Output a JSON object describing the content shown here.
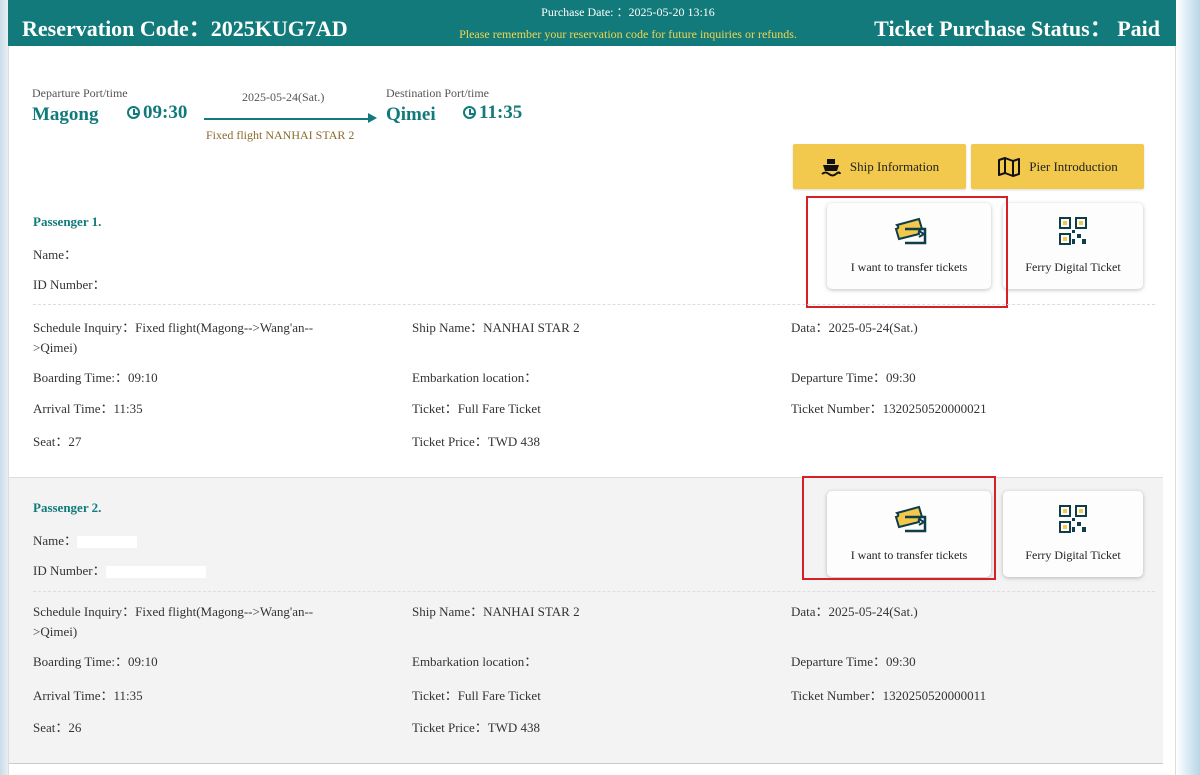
{
  "header": {
    "reservation_label": "Reservation Code：2025KUG7AD",
    "purchase_date": "Purchase Date: ：2025-05-20 13:16",
    "reminder": "Please remember your reservation code for future inquiries or refunds.",
    "status": "Ticket Purchase Status： Paid"
  },
  "route": {
    "departure_label": "Departure Port/time",
    "departure_port": "Magong",
    "departure_time": "09:30",
    "date": "2025-05-24(Sat.)",
    "flight": "Fixed flight NANHAI STAR 2",
    "destination_label": "Destination Port/time",
    "destination_port": "Qimei",
    "arrival_time": "11:35"
  },
  "buttons": {
    "ship_info": "Ship Information",
    "pier_intro": "Pier Introduction",
    "transfer": "I want to transfer tickets",
    "digital_ticket": "Ferry Digital Ticket"
  },
  "passengers": [
    {
      "title": "Passenger 1.",
      "name_label": "Name：",
      "id_label": "ID Number：",
      "schedule": "Schedule Inquiry：Fixed flight(Magong-->Wang'an--",
      "schedule_cont": ">Qimei)",
      "ship_name": "Ship Name：NANHAI STAR 2",
      "date": "Data：2025-05-24(Sat.)",
      "boarding": "Boarding Time:：09:10",
      "embarkation": "Embarkation location：",
      "departure": "Departure Time：09:30",
      "arrival": "Arrival Time：11:35",
      "ticket": "Ticket：Full Fare Ticket",
      "ticket_number": "Ticket Number：1320250520000021",
      "seat": "Seat：27",
      "price": "Ticket Price：TWD 438"
    },
    {
      "title": "Passenger 2.",
      "name_label": "Name：",
      "id_label": "ID Number：",
      "schedule": "Schedule Inquiry：Fixed flight(Magong-->Wang'an--",
      "schedule_cont": ">Qimei)",
      "ship_name": "Ship Name：NANHAI STAR 2",
      "date": "Data：2025-05-24(Sat.)",
      "boarding": "Boarding Time:：09:10",
      "embarkation": "Embarkation location：",
      "departure": "Departure Time：09:30",
      "arrival": "Arrival Time：11:35",
      "ticket": "Ticket：Full Fare Ticket",
      "ticket_number": "Ticket Number：1320250520000011",
      "seat": "Seat：26",
      "price": "Ticket Price：TWD 438"
    }
  ],
  "colors": {
    "header_bg": "#127a7a",
    "accent_yellow": "#f2c94c",
    "reminder_text": "#f2d552",
    "highlight_red": "#d61f26"
  }
}
